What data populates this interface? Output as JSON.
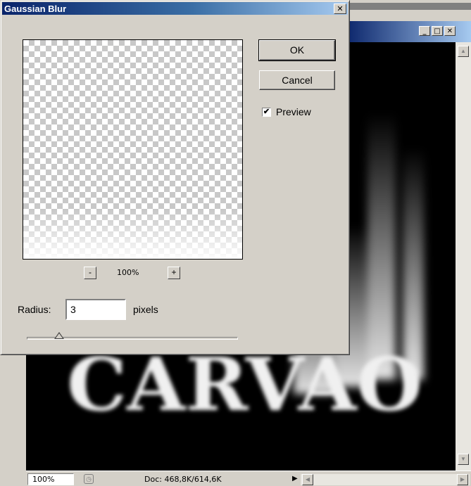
{
  "dialog": {
    "title": "Gaussian Blur",
    "close_glyph": "✕",
    "ok_label": "OK",
    "cancel_label": "Cancel",
    "preview_label": "Preview",
    "preview_checked": true,
    "zoom_out": "-",
    "zoom_level": "100%",
    "zoom_in": "+",
    "radius_label": "Radius:",
    "radius_value": "3",
    "radius_unit": "pixels"
  },
  "document": {
    "min_glyph": "_",
    "max_glyph": "□",
    "close_glyph": "✕",
    "canvas_text": "CARVAO",
    "zoom": "100%",
    "doc_size": "Doc: 468,8K/614,6K"
  }
}
